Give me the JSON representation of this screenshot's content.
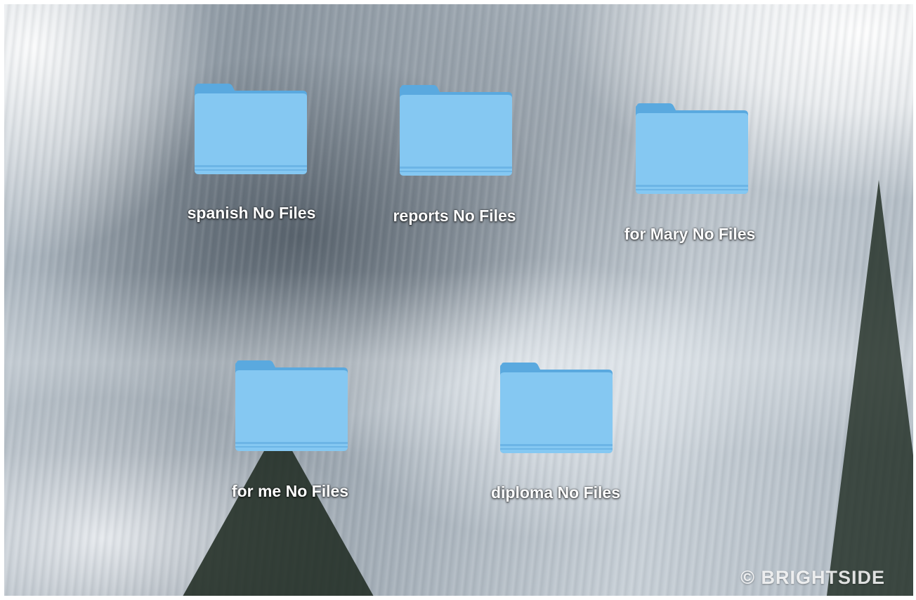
{
  "desktop": {
    "folders": [
      {
        "name": "spanish",
        "label": "spanish No Files"
      },
      {
        "name": "reports",
        "label": "reports No Files"
      },
      {
        "name": "for-mary",
        "label": "for Mary No Files"
      },
      {
        "name": "for-me",
        "label": "for me No Files"
      },
      {
        "name": "diploma",
        "label": "diploma No Files"
      }
    ],
    "icon": "folder-icon",
    "folder_color": "#7fc4f0"
  },
  "watermark": {
    "text": "© BRIGHTSIDE"
  }
}
